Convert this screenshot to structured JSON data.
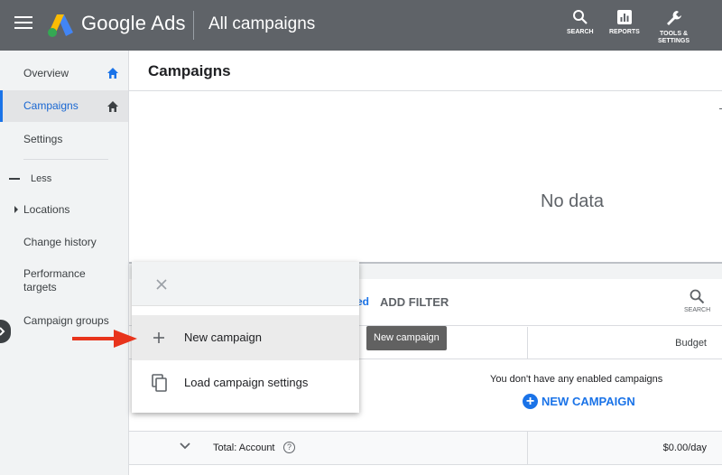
{
  "topbar": {
    "brand": "Google Ads",
    "page_heading": "All campaigns",
    "tools": [
      {
        "label": "SEARCH",
        "icon": "search-icon"
      },
      {
        "label": "REPORTS",
        "icon": "reports-icon"
      },
      {
        "label_line1": "TOOLS &",
        "label_line2": "SETTINGS",
        "icon": "wrench-icon"
      }
    ]
  },
  "sidebar": {
    "items": [
      {
        "label": "Overview",
        "icon": "home-icon"
      },
      {
        "label": "Campaigns",
        "icon": "home-icon",
        "active": true
      },
      {
        "label": "Settings"
      },
      {
        "label": "Less"
      },
      {
        "label": "Locations"
      },
      {
        "label": "Change history"
      },
      {
        "label_line1": "Performance",
        "label_line2": "targets"
      },
      {
        "label": "Campaign groups"
      }
    ]
  },
  "main": {
    "title": "Campaigns",
    "no_data": "No data",
    "filter_partial": "ed",
    "add_filter": "ADD FILTER",
    "search_label": "SEARCH",
    "budget_header": "Budget",
    "empty_message": "You don't have any enabled campaigns",
    "new_campaign_button": "NEW CAMPAIGN",
    "total_label": "Total: Account",
    "total_budget": "$0.00/day"
  },
  "popup": {
    "items": [
      {
        "label": "New campaign",
        "icon": "plus-icon"
      },
      {
        "label": "Load campaign settings",
        "icon": "copy-icon"
      }
    ]
  },
  "tooltip": "New campaign",
  "colors": {
    "topbar": "#5f6368",
    "accent": "#1a73e8",
    "arrow": "#e8341c"
  }
}
